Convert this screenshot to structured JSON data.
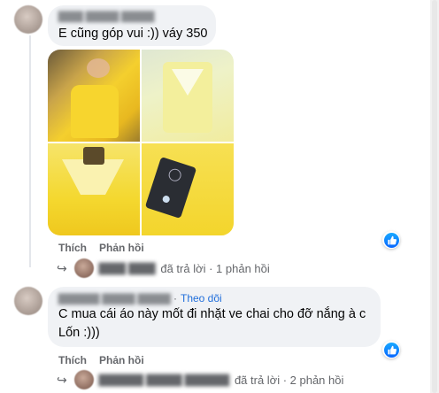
{
  "comment1": {
    "text": "E cũng góp vui :)) váy 350",
    "actions": {
      "like": "Thích",
      "reply": "Phản hồi"
    },
    "replies_summary": "đã trả lời · 1 phản hồi"
  },
  "comment2": {
    "follow": "Theo dõi",
    "text_line1": "C mua cái áo này mốt đi nhặt ve chai cho đỡ nắng à c",
    "text_line2": "Lốn :)))",
    "actions": {
      "like": "Thích",
      "reply": "Phản hồi"
    },
    "replies_summary": "đã trả lời · 2 phản hồi"
  },
  "icons": {
    "like": "thumbs-up-icon",
    "reply_arrow": "reply-arrow-icon",
    "tag": "price-tag-icon"
  },
  "colors": {
    "bubble": "#f0f2f5",
    "link": "#216fdb",
    "like_blue": "#0866ff",
    "dress_yellow": "#f5d63b"
  }
}
